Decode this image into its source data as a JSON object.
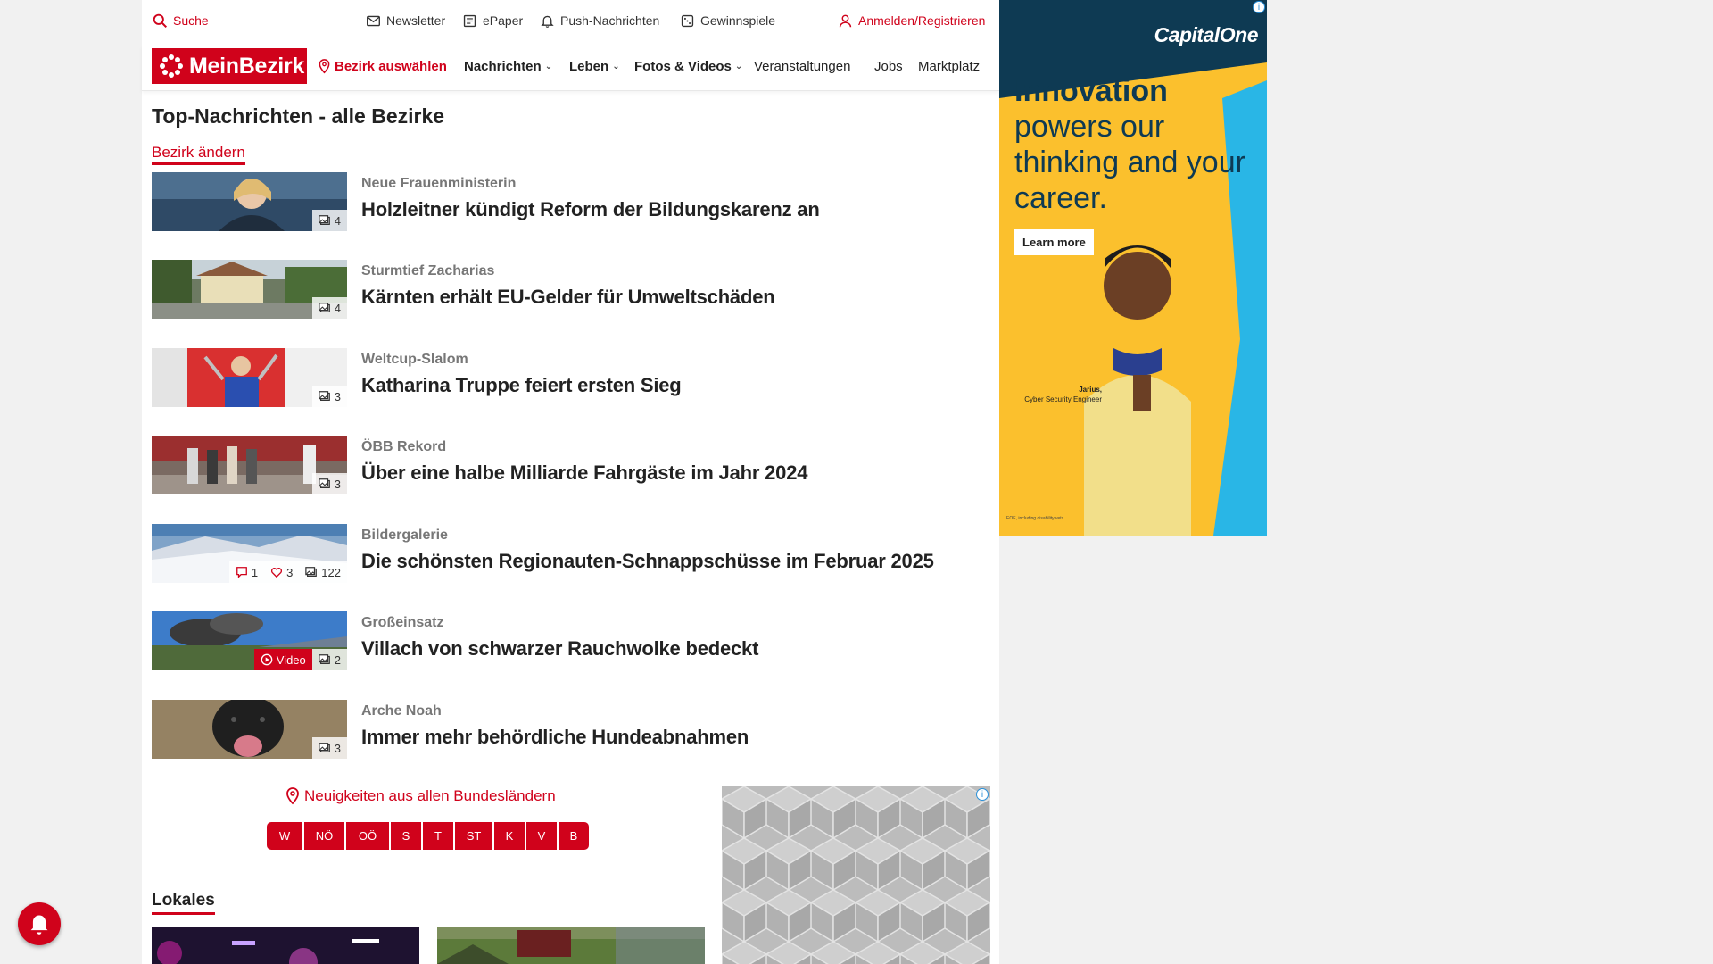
{
  "utility_bar": {
    "search": "Suche",
    "newsletter": "Newsletter",
    "epaper": "ePaper",
    "push": "Push-Nachrichten",
    "games": "Gewinnspiele",
    "login": "Anmelden/Registrieren"
  },
  "nav": {
    "logo": "MeinBezirk",
    "select_district": "Bezirk auswählen",
    "items": [
      "Nachrichten",
      "Leben",
      "Fotos & Videos",
      "Veranstaltungen",
      "Jobs",
      "Marktplatz"
    ]
  },
  "main": {
    "title": "Top-Nachrichten - alle Bezirke",
    "change_district": "Bezirk ändern",
    "articles": [
      {
        "kicker": "Neue Frauenministerin",
        "headline": "Holzleitner kündigt Reform der Bildungskarenz an",
        "photos": "4"
      },
      {
        "kicker": "Sturmtief Zacharias",
        "headline": "Kärnten erhält EU-Gelder für Umweltschäden",
        "photos": "4"
      },
      {
        "kicker": "Weltcup-Slalom",
        "headline": "Katharina Truppe feiert ersten Sieg",
        "photos": "3"
      },
      {
        "kicker": "ÖBB Rekord",
        "headline": "Über eine halbe Milliarde Fahrgäste im Jahr 2024",
        "photos": "3"
      },
      {
        "kicker": "Bildergalerie",
        "headline": "Die schönsten Regionauten-Schnappschüsse im Februar 2025",
        "comments": "1",
        "likes": "3",
        "photos": "122"
      },
      {
        "kicker": "Großeinsatz",
        "headline": "Villach von schwarzer Rauchwolke bedeckt",
        "video": "Video",
        "photos": "2"
      },
      {
        "kicker": "Arche Noah",
        "headline": "Immer mehr behördliche Hundeabnahmen",
        "photos": "3"
      }
    ]
  },
  "regions": {
    "title": "Neuigkeiten aus allen Bundesländern",
    "buttons": [
      "W",
      "NÖ",
      "OÖ",
      "S",
      "T",
      "ST",
      "K",
      "V",
      "B"
    ]
  },
  "lokales": {
    "title": "Lokales"
  },
  "ad": {
    "brand": "CapitalOne",
    "headline_bold": "Innovation",
    "headline_rest": "powers our thinking and your career.",
    "cta": "Learn more",
    "caption_name": "Jarius,",
    "caption_role": "Cyber Security Engineer",
    "footnote": "EOE, including disability/vets"
  },
  "colors": {
    "brand_red": "#d0021b",
    "ad_navy": "#0e3a53",
    "ad_yellow": "#fbc02d",
    "ad_cyan": "#29b6e6"
  }
}
